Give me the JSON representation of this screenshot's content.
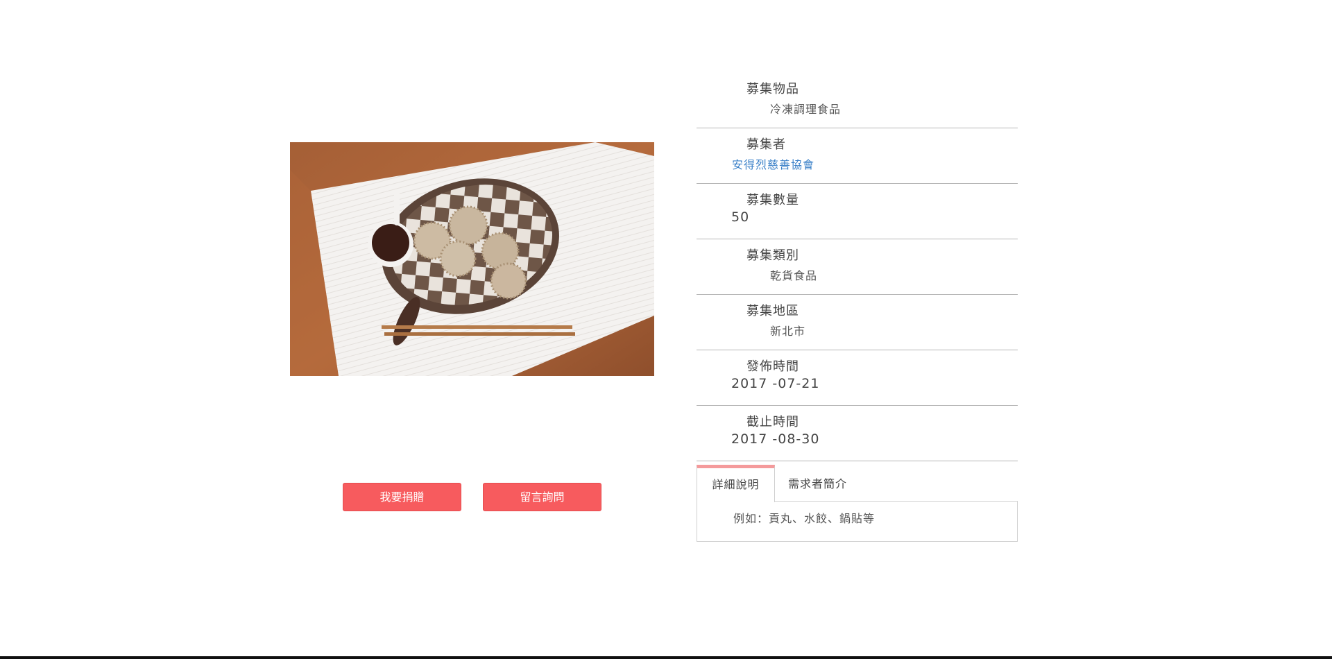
{
  "item": {
    "image_alt": "冷凍調理食品"
  },
  "actions": {
    "donate_label": "我要捐贈",
    "ask_label": "留言詢問"
  },
  "fields": [
    {
      "label": "募集物品",
      "value": "冷凍調理食品"
    },
    {
      "label": "募集者",
      "value": "安得烈慈善協會"
    },
    {
      "label": "募集數量",
      "value": "50"
    },
    {
      "label": "募集類別",
      "value": "乾貨食品"
    },
    {
      "label": "募集地區",
      "value": "新北市"
    },
    {
      "label": "發佈時間",
      "value": "2017 -07-21"
    },
    {
      "label": "截止時間",
      "value": "2017 -08-30"
    }
  ],
  "tabs": {
    "items": [
      {
        "label": "詳細說明"
      },
      {
        "label": "需求者簡介"
      }
    ],
    "active_content": "例如：貢丸、水餃、鍋貼等"
  },
  "colors": {
    "button": "#f75b5e",
    "link": "#3a80c8",
    "tab_accent": "#f49a9b"
  }
}
